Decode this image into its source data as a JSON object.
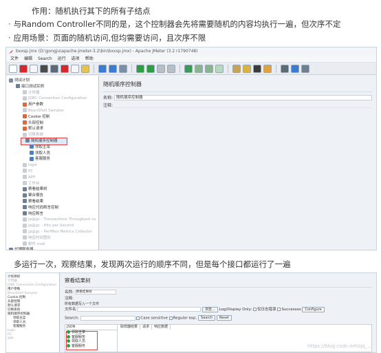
{
  "doc": {
    "line1": "作用：随机执行其下的所有子结点",
    "line2": "与Random Controller不同的是，这个控制器会先将需要随机的内容均执行一遍，但次序不定",
    "line3": "应用场景：页面的随机访问,但均需要访问，且次序不限",
    "line4": "多运行一次，观察结果，发现两次运行的顺序不同，但是每个接口都运行了一遍",
    "bullet": "·"
  },
  "shot1": {
    "window_title": "bxxsp.jmx (D:\\gongju\\apache-jmeter-3.2\\bin\\bxxsp.jmx) - Apache JMeter (3.2 r1790748)",
    "menu": [
      "文件",
      "编辑",
      "Search",
      "运行",
      "选项",
      "帮助"
    ],
    "tree": [
      {
        "label": "测试计划",
        "level": 0,
        "icon": "test-plan-icon",
        "color": "#7a8fa6",
        "dim": false
      },
      {
        "label": "接口测试实例",
        "level": 1,
        "icon": "thread-group-icon",
        "color": "#6e7f93",
        "dim": false
      },
      {
        "label": "计时器",
        "level": 2,
        "icon": "timer-icon",
        "color": "#c9ced4",
        "dim": true
      },
      {
        "label": "JDBC Connection Configuration",
        "level": 2,
        "icon": "jdbc-icon",
        "color": "#c9ced4",
        "dim": true
      },
      {
        "label": "用户参数",
        "level": 2,
        "icon": "params-icon",
        "color": "#d96a3b",
        "dim": false
      },
      {
        "label": "BeanShell Sampler",
        "level": 2,
        "icon": "beanshell-icon",
        "color": "#c9ced4",
        "dim": true
      },
      {
        "label": "Cookie 控制",
        "level": 2,
        "icon": "cookie-icon",
        "color": "#d96a3b",
        "dim": false
      },
      {
        "label": "头部控制",
        "level": 2,
        "icon": "header-icon",
        "color": "#d96a3b",
        "dim": false
      },
      {
        "label": "默认请求",
        "level": 2,
        "icon": "defaults-icon",
        "color": "#d96a3b",
        "dim": false
      },
      {
        "label": "切换系统",
        "level": 2,
        "icon": "switch-icon",
        "color": "#c9ced4",
        "dim": true
      },
      {
        "label": "随机顺序控制器",
        "level": 2,
        "icon": "random-order-icon",
        "color": "#6e7f93",
        "dim": false,
        "highlight": true
      },
      {
        "label": "领取主菜",
        "level": 3,
        "icon": "sampler-icon",
        "color": "#4a7fc1",
        "dim": false
      },
      {
        "label": "领取人员",
        "level": 3,
        "icon": "sampler-icon",
        "color": "#4a7fc1",
        "dim": false
      },
      {
        "label": "客服服务",
        "level": 3,
        "icon": "sampler-icon",
        "color": "#4a7fc1",
        "dim": false
      },
      {
        "label": "login",
        "level": 2,
        "icon": "folder-icon",
        "color": "#c9ced4",
        "dim": true
      },
      {
        "label": "PC",
        "level": 2,
        "icon": "folder-icon",
        "color": "#c9ced4",
        "dim": true
      },
      {
        "label": "APP",
        "level": 2,
        "icon": "folder-icon",
        "color": "#c9ced4",
        "dim": true
      },
      {
        "label": "工作台",
        "level": 2,
        "icon": "folder-icon",
        "color": "#c9ced4",
        "dim": true
      },
      {
        "label": "察看结果树",
        "level": 2,
        "icon": "listener-icon",
        "color": "#6e7f93",
        "dim": false
      },
      {
        "label": "聚合报告",
        "level": 2,
        "icon": "listener-icon",
        "color": "#6e7f93",
        "dim": false
      },
      {
        "label": "察看结果",
        "level": 2,
        "icon": "listener-icon",
        "color": "#6e7f93",
        "dim": false
      },
      {
        "label": "响应代码断言控制",
        "level": 2,
        "icon": "assertion-icon",
        "color": "#6e7f93",
        "dim": false
      },
      {
        "label": "响应断言",
        "level": 2,
        "icon": "assertion-icon",
        "color": "#6e7f93",
        "dim": false
      },
      {
        "label": "jp@gc - Transactions Throughput vs",
        "level": 2,
        "icon": "graph-icon",
        "color": "#c9ced4",
        "dim": true
      },
      {
        "label": "jp@gc - Hits per Second",
        "level": 2,
        "icon": "graph-icon",
        "color": "#c9ced4",
        "dim": true
      },
      {
        "label": "jp@gc - PerfMon Metrics Collector",
        "level": 2,
        "icon": "graph-icon",
        "color": "#c9ced4",
        "dim": true
      },
      {
        "label": "响应时间图形",
        "level": 2,
        "icon": "graph-icon",
        "color": "#c9ced4",
        "dim": true
      },
      {
        "label": "邮件 mail",
        "level": 2,
        "icon": "mail-icon",
        "color": "#c9ced4",
        "dim": true
      },
      {
        "label": "代理服务器",
        "level": 0,
        "icon": "proxy-icon",
        "color": "#6e7f93",
        "dim": false
      }
    ],
    "panel_title": "随机顺序控制器",
    "name_label": "名称:",
    "name_value": "随机顺序控制器",
    "comment_label": "注释:"
  },
  "shot2": {
    "tree": [
      {
        "label": "计划目标",
        "dim": false
      },
      {
        "label": "计时器",
        "dim": true
      },
      {
        "label": "JDBC Connection Configuration",
        "dim": true
      },
      {
        "label": "用户参数",
        "dim": false
      },
      {
        "label": "BeanShell Sampler",
        "dim": true
      },
      {
        "label": "Cookie 控制",
        "dim": false
      },
      {
        "label": "头部控制",
        "dim": false
      },
      {
        "label": "默认请求",
        "dim": false
      },
      {
        "label": "切换系统",
        "dim": false
      },
      {
        "label": "随机顺序控制器",
        "dim": false
      },
      {
        "label": "领取主菜",
        "dim": false
      },
      {
        "label": "领取人员",
        "dim": false
      },
      {
        "label": "客服服务",
        "dim": false
      },
      {
        "label": "login",
        "dim": true
      },
      {
        "label": "PC",
        "dim": true
      },
      {
        "label": "APP",
        "dim": true
      }
    ],
    "panel_title": "察看结果树",
    "name_label": "名称:",
    "name_value": "察看结果树",
    "comment_label": "注释:",
    "file_section": "所有数据写入一个文件",
    "file_label": "文件名",
    "browse_btn": "浏览...",
    "log_display_only": "Log/Display Only:",
    "errors_label": "仅日志错误",
    "successes_label": "Successes",
    "configure_btn": "Configure",
    "search_label": "Search:",
    "case_sensitive": "Case sensitive",
    "regular_exp": "Regular exp.",
    "search_btn": "Search",
    "reset_btn": "Reset",
    "renderer": "JSON",
    "tabs": [
      "取样器结果",
      "请求",
      "响应数据"
    ],
    "results": [
      "领取主菜",
      "客服服务",
      "领取人员",
      "客服服务"
    ]
  },
  "watermark": "https://blog.csdn.net/qq_..."
}
